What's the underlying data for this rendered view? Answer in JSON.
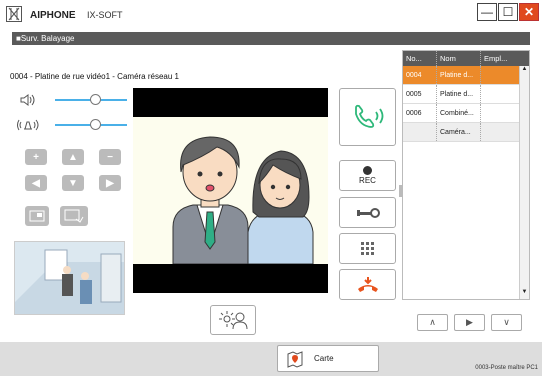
{
  "window": {
    "brand": "AIPHONE",
    "product": "IX-SOFT",
    "minimize": "—",
    "maximize": "☐",
    "close": "✕"
  },
  "subtitle": "■Surv. Balayage",
  "camera_title": "0004 - Platine de rue vidéo1 - Caméra réseau 1",
  "volume": {
    "speaker_level": 0.55,
    "mic_level": 0.55
  },
  "ptz": {
    "zoom_in": "+",
    "up": "▲",
    "zoom_out": "−",
    "left": "◀",
    "down": "▼",
    "right": "▶"
  },
  "actions": {
    "rec_label": "REC"
  },
  "table": {
    "headers": [
      "No...",
      "Nom",
      "Empl..."
    ],
    "rows": [
      {
        "no": "0004",
        "name": "Platine d...",
        "loc": "",
        "selected": true
      },
      {
        "no": "0005",
        "name": "Platine d...",
        "loc": "",
        "selected": false
      },
      {
        "no": "0006",
        "name": "Combiné...",
        "loc": "",
        "selected": false
      },
      {
        "no": "",
        "name": "Caméra...",
        "loc": "",
        "selected": false
      }
    ]
  },
  "nav": {
    "up": "∧",
    "play": "▶",
    "down": "∨"
  },
  "footer": {
    "carte_label": "Carte",
    "status": "0003-Poste maître PC1"
  },
  "colors": {
    "accent_blue": "#4ab0e8",
    "selected_row": "#ec8a2a",
    "answer_green": "#2eb87a",
    "hangup_orange": "#e8541e"
  }
}
